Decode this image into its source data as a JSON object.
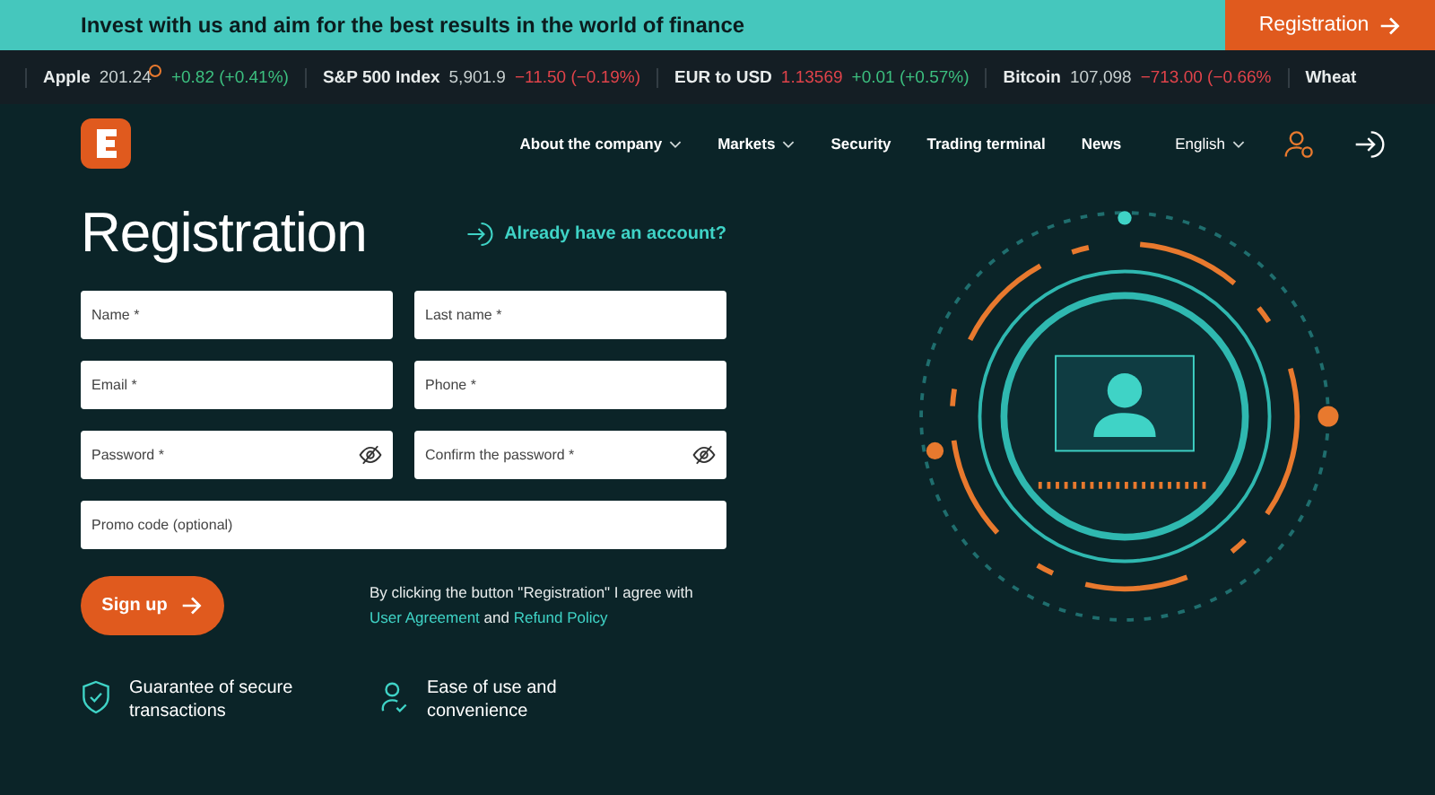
{
  "banner": {
    "text": "Invest with us and aim for the best results in the world of finance",
    "button": "Registration"
  },
  "ticker": [
    {
      "name": "Apple",
      "price": {
        "text": "201.24",
        "negative": false
      },
      "change": {
        "text": "+0.82 (+0.41%)",
        "negative": false
      }
    },
    {
      "name": "S&P 500 Index",
      "price": {
        "text": "5,901.9",
        "negative": false
      },
      "change": {
        "text": "−11.50 (−0.19%)",
        "negative": true
      }
    },
    {
      "name": "EUR to USD",
      "price": {
        "text": "1.13569",
        "negative": true
      },
      "change": {
        "text": "+0.01 (+0.57%)",
        "negative": false
      }
    },
    {
      "name": "Bitcoin",
      "price": {
        "text": "107,098",
        "negative": false
      },
      "change": {
        "text": "−713.00 (−0.66%",
        "negative": true
      }
    },
    {
      "name": "Wheat"
    }
  ],
  "nav": {
    "items": [
      {
        "label": "About the company",
        "dropdown": true
      },
      {
        "label": "Markets",
        "dropdown": true
      },
      {
        "label": "Security",
        "dropdown": false
      },
      {
        "label": "Trading terminal",
        "dropdown": false
      },
      {
        "label": "News",
        "dropdown": false
      }
    ],
    "language": "English"
  },
  "form": {
    "title": "Registration",
    "login_link": "Already have an account?",
    "fields": [
      {
        "placeholder": "Name *",
        "kind": "text"
      },
      {
        "placeholder": "Last name *",
        "kind": "text"
      },
      {
        "placeholder": "Email *",
        "kind": "text"
      },
      {
        "placeholder": "Phone *",
        "kind": "text"
      },
      {
        "placeholder": "Password *",
        "kind": "password"
      },
      {
        "placeholder": "Confirm the password *",
        "kind": "password"
      },
      {
        "placeholder": "Promo code (optional)",
        "kind": "wide"
      }
    ],
    "submit": "Sign up",
    "consent": [
      {
        "kind": "text",
        "text": "By clicking the button \"Registration\" I agree with "
      },
      {
        "kind": "link",
        "text": "User Agreement"
      },
      {
        "kind": "text",
        "text": " and "
      },
      {
        "kind": "link",
        "text": "Refund Policy"
      }
    ]
  },
  "features": [
    {
      "kind": "shield",
      "text": "Guarantee of secure transactions"
    },
    {
      "kind": "user",
      "text": "Ease of use and convenience"
    }
  ]
}
